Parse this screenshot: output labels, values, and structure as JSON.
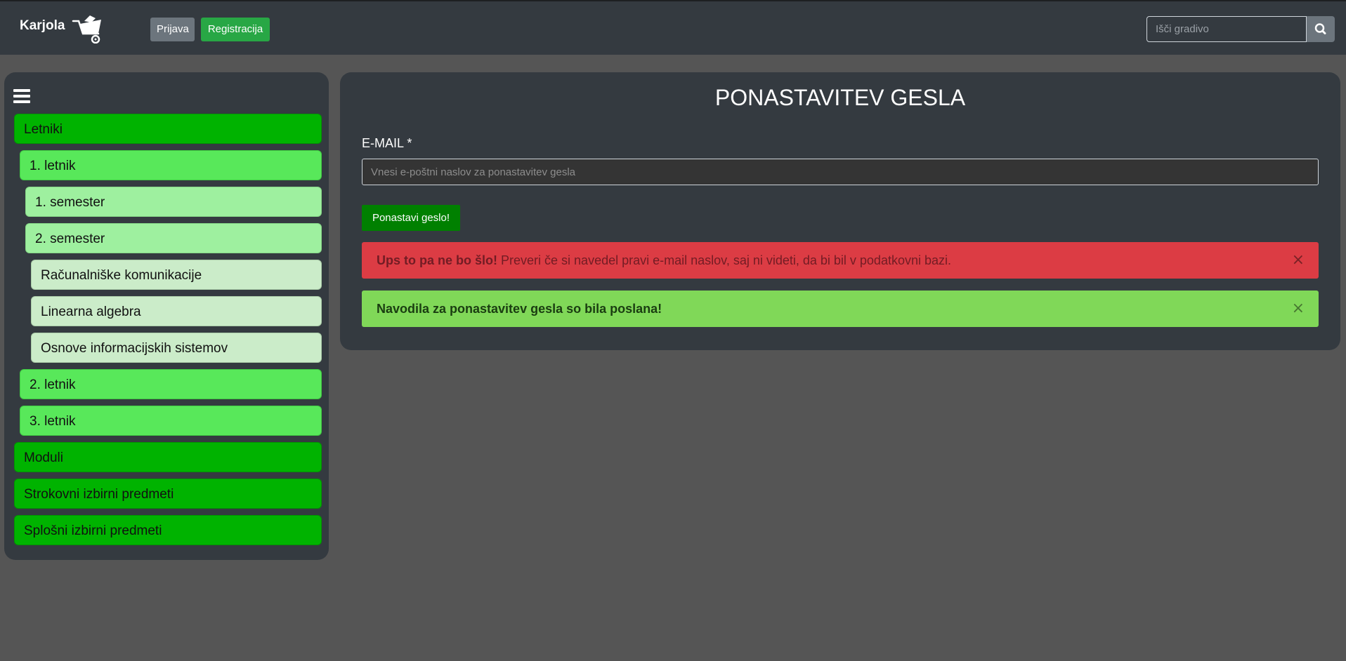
{
  "navbar": {
    "brand": "Karjola",
    "brand_icon": "wheelbarrow-icon",
    "login_label": "Prijava",
    "register_label": "Registracija",
    "search_placeholder": "Išči gradivo",
    "search_icon": "search-icon"
  },
  "sidebar": {
    "toggle_icon": "hamburger-icon",
    "items": [
      {
        "label": "Letniki",
        "level": 0
      },
      {
        "label": "1. letnik",
        "level": 1
      },
      {
        "label": "1. semester",
        "level": 2
      },
      {
        "label": "2. semester",
        "level": 2
      },
      {
        "label": "Računalniške komunikacije",
        "level": 3
      },
      {
        "label": "Linearna algebra",
        "level": 3
      },
      {
        "label": "Osnove informacijskih sistemov",
        "level": 3
      },
      {
        "label": "2. letnik",
        "level": 1
      },
      {
        "label": "3. letnik",
        "level": 1
      },
      {
        "label": "Moduli",
        "level": 0
      },
      {
        "label": "Strokovni izbirni predmeti",
        "level": 0
      },
      {
        "label": "Splošni izbirni predmeti",
        "level": 0
      }
    ]
  },
  "main": {
    "title": "PONASTAVITEV GESLA",
    "email_label": "E-MAIL *",
    "email_placeholder": "Vnesi e-poštni naslov za ponastavitev gesla",
    "submit_label": "Ponastavi geslo!",
    "error_alert": {
      "strong": "Ups to pa ne bo šlo!",
      "text": " Preveri če si navedel pravi e-mail naslov, saj ni videti, da bi bil v podatkovni bazi.",
      "close": "×"
    },
    "success_alert": {
      "strong": "Navodila za ponastavitev gesla so bila poslana!",
      "close": "×"
    }
  },
  "colors": {
    "background": "#555555",
    "navbar": "#343a40",
    "level0": "#00b300",
    "level1": "#58e85a",
    "level2": "#9ef09f",
    "level3": "#cbecc9",
    "danger": "#dc3c44",
    "success": "#80d858"
  }
}
